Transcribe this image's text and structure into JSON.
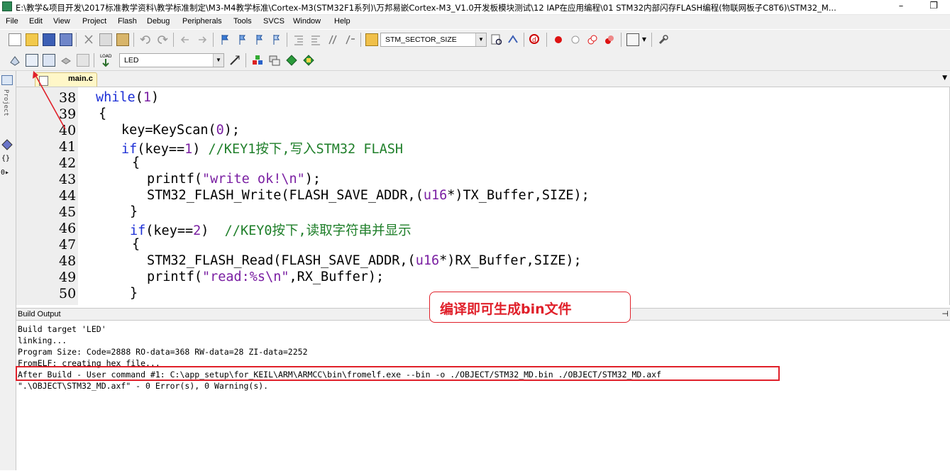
{
  "window": {
    "title": "E:\\教学&项目开发\\2017标准教学资料\\教学标准制定\\M3-M4教学标准\\Cortex-M3(STM32F1系列)\\万邦易嵌Cortex-M3_V1.0开发板模块测试\\12 IAP在应用编程\\01 STM32内部闪存FLASH编程(物联网板子C8T6)\\STM32_M...",
    "minimize_label": "–",
    "restore_label": "❐"
  },
  "menu": {
    "items": [
      "File",
      "Edit",
      "View",
      "Project",
      "Flash",
      "Debug",
      "Peripherals",
      "Tools",
      "SVCS",
      "Window",
      "Help"
    ]
  },
  "toolbar": {
    "find_combo_value": "STM_SECTOR_SIZE",
    "target_combo_value": "LED"
  },
  "sidebar": {
    "project_label": "Project"
  },
  "editor": {
    "tab_label": "main.c",
    "lines": [
      {
        "num": "38"
      },
      {
        "num": "39"
      },
      {
        "num": "40"
      },
      {
        "num": "41"
      },
      {
        "num": "42"
      },
      {
        "num": "43"
      },
      {
        "num": "44"
      },
      {
        "num": "45"
      },
      {
        "num": "46"
      },
      {
        "num": "47"
      },
      {
        "num": "48"
      },
      {
        "num": "49"
      },
      {
        "num": "50"
      }
    ],
    "code": {
      "l38_kw": "while",
      "l38_p1": "(",
      "l38_num": "1",
      "l38_p2": ")",
      "l39": "{",
      "l40_a": "key=KeyScan(",
      "l40_num": "0",
      "l40_b": ");",
      "l41_kw": "if",
      "l41_a": "(key==",
      "l41_num": "1",
      "l41_b": ") ",
      "l41_cmt": "//KEY1按下,写入STM32 FLASH",
      "l42": "{",
      "l43_a": "printf(",
      "l43_str": "\"write ok!\\n\"",
      "l43_b": ");",
      "l44_a": "STM32_FLASH_Write(FLASH_SAVE_ADDR,(",
      "l44_kw": "u16",
      "l44_b": "*)TX_Buffer,SIZE);",
      "l45": "}",
      "l46_kw": "if",
      "l46_a": "(key==",
      "l46_num": "2",
      "l46_b": ")  ",
      "l46_cmt": "//KEY0按下,读取字符串并显示",
      "l47": "{",
      "l48_a": "STM32_FLASH_Read(FLASH_SAVE_ADDR,(",
      "l48_kw": "u16",
      "l48_b": "*)RX_Buffer,SIZE);",
      "l49_a": "printf(",
      "l49_str": "\"read:%s\\n\"",
      "l49_b": ",RX_Buffer);",
      "l50": "}"
    }
  },
  "build_output": {
    "title": "Build Output",
    "lines": [
      "Build target 'LED'",
      "linking...",
      "Program Size: Code=2888 RO-data=368 RW-data=28 ZI-data=2252",
      "FromELF: creating hex file...",
      "After Build - User command #1: C:\\app_setup\\for_KEIL\\ARM\\ARMCC\\bin\\fromelf.exe --bin -o ./OBJECT/STM32_MD.bin ./OBJECT/STM32_MD.axf",
      "\".\\OBJECT\\STM32_MD.axf\" - 0 Error(s), 0 Warning(s)."
    ]
  },
  "annotation": {
    "callout_text": "编译即可生成bin文件",
    "color": "#e0202a"
  },
  "colors": {
    "keyword": "#1c2fd6",
    "number": "#7a1fa2",
    "comment": "#1f7f2a",
    "tab_bg": "#fff7c8"
  }
}
